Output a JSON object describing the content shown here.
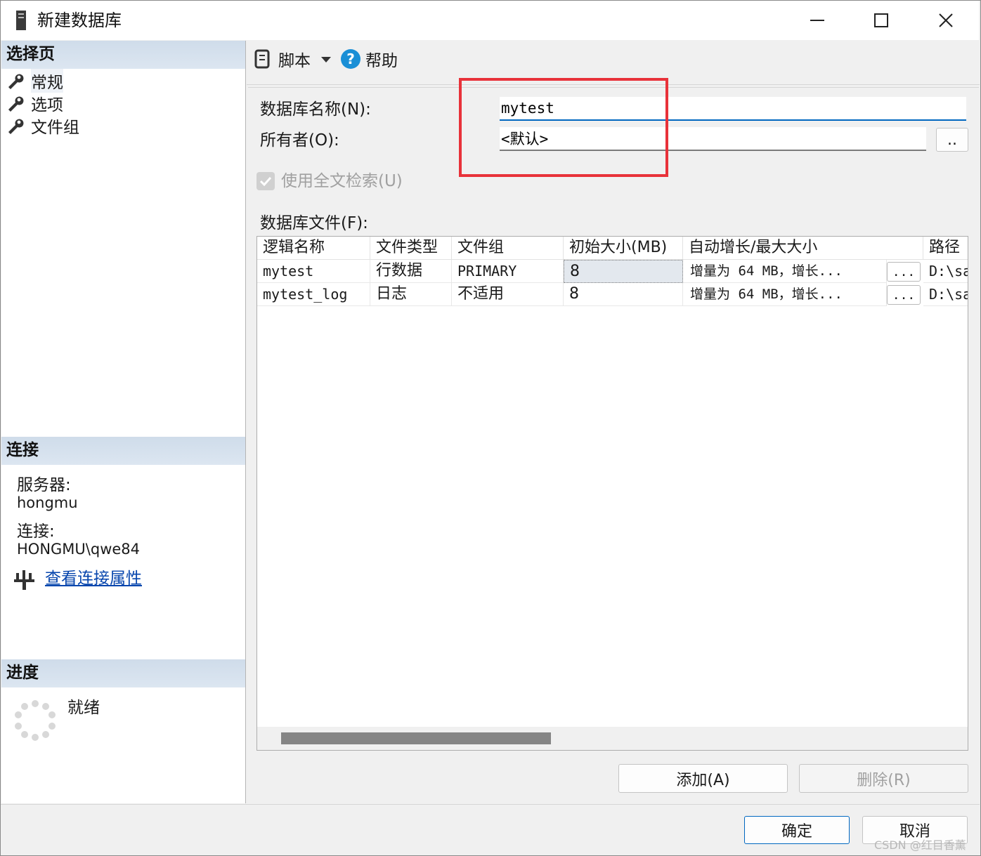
{
  "window": {
    "title": "新建数据库",
    "minimize_label": "—",
    "maximize_label": "□",
    "close_label": "✕"
  },
  "sidebar": {
    "select_page_header": "选择页",
    "nav_items": [
      {
        "label": "常规",
        "icon": "wrench-icon"
      },
      {
        "label": "选项",
        "icon": "wrench-icon"
      },
      {
        "label": "文件组",
        "icon": "wrench-icon"
      }
    ],
    "connection_header": "连接",
    "server_label": "服务器:",
    "server_value": "hongmu",
    "connection_label": "连接:",
    "connection_value": "HONGMU\\qwe84",
    "view_properties_link": "查看连接属性",
    "progress_header": "进度",
    "progress_status": "就绪"
  },
  "toolbar": {
    "script_label": "脚本",
    "help_label": "帮助"
  },
  "form": {
    "db_name_label": "数据库名称(N):",
    "db_name_value": "mytest",
    "owner_label": "所有者(O):",
    "owner_value": "<默认>",
    "owner_browse_label": "..",
    "fulltext_label": "使用全文检索(U)",
    "fulltext_checked": true,
    "db_files_label": "数据库文件(F):"
  },
  "files_table": {
    "columns": [
      "逻辑名称",
      "文件类型",
      "文件组",
      "初始大小(MB)",
      "自动增长/最大大小",
      "路径"
    ],
    "rows": [
      {
        "logical_name": "mytest",
        "file_type": "行数据",
        "filegroup": "PRIMARY",
        "initial_size": "8",
        "autogrowth": "增量为 64 MB，增长...",
        "browse": "...",
        "path": "D:\\sa"
      },
      {
        "logical_name": "mytest_log",
        "file_type": "日志",
        "filegroup": "不适用",
        "initial_size": "8",
        "autogrowth": "增量为 64 MB，增长...",
        "browse": "...",
        "path": "D:\\sa"
      }
    ]
  },
  "buttons": {
    "add": "添加(A)",
    "remove": "删除(R)",
    "ok": "确定",
    "cancel": "取消"
  },
  "watermark": "CSDN @红目香薰",
  "colors": {
    "header_bg": "#d5e1ee",
    "highlight": "#e8323a",
    "link": "#0645ad",
    "input_focus": "#0067c0"
  }
}
